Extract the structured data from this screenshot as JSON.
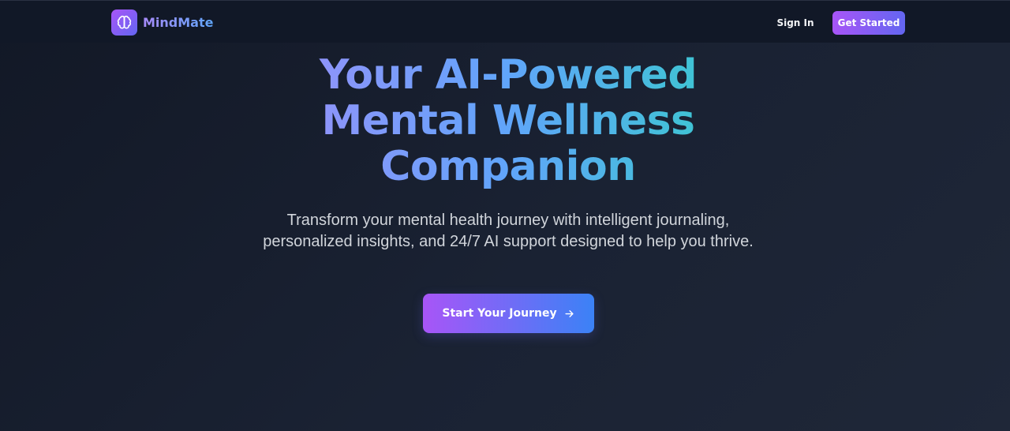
{
  "navbar": {
    "brand_name": "MindMate",
    "brand_icon": "brain-icon",
    "signin_label": "Sign In",
    "get_started_label": "Get Started"
  },
  "hero": {
    "title_line1": "Your AI-Powered",
    "title_line2": "Mental Wellness",
    "title_line3": "Companion",
    "subtitle": "Transform your mental health journey with intelligent journaling, personalized insights, and 24/7 AI support designed to help you thrive.",
    "cta_label": "Start Your Journey",
    "cta_icon": "arrow-right-icon"
  },
  "colors": {
    "background": "#121826",
    "navbar": "#111827",
    "accent_purple": "#a855f7",
    "accent_blue": "#3b82f6",
    "accent_teal": "#2dd4bf"
  }
}
